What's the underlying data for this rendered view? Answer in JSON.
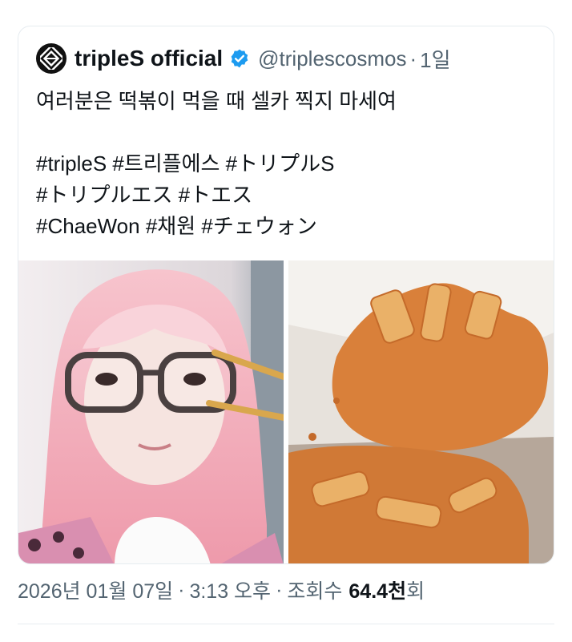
{
  "tweet": {
    "author_name": "tripleS official",
    "handle": "@triplescosmos",
    "separator": "·",
    "time": "1일",
    "text": "여러분은 떡볶이 먹을 때 셀카 찍지 마세여\n\n#tripleS #트리플에스 #トリプルS\n#トリプルエス #トエス\n#ChaeWon #채원 #チェウォン",
    "colors": {
      "verified": "#1d9bf0",
      "secondary_text": "#536471",
      "text": "#0f1419"
    }
  },
  "media": {
    "photo1": {
      "subject": "selfie-pink-hair-glasses-chopsticks"
    },
    "photo2": {
      "subject": "spilled-tteokbokki-on-floor"
    }
  },
  "footer": {
    "date": "2026년 01월 07일",
    "sep1": "·",
    "clock": "3:13 오후",
    "sep2": "·",
    "views_label": "조회수",
    "views_value": "64.4천",
    "views_suffix": "회"
  }
}
